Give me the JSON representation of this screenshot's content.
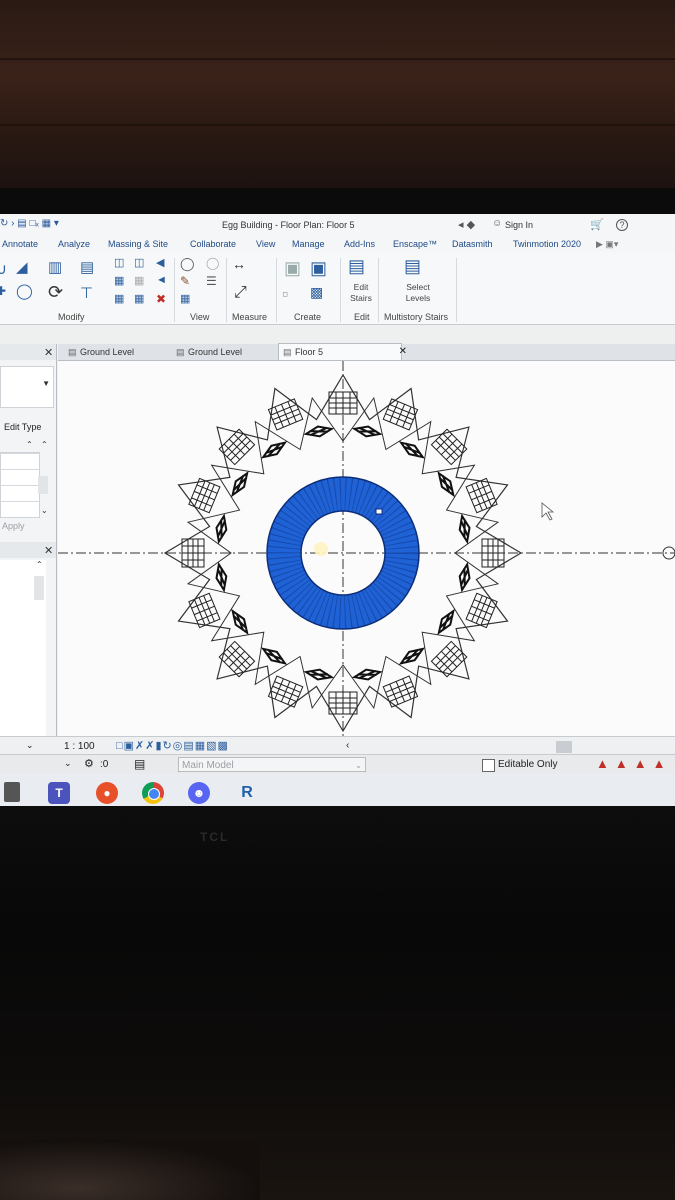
{
  "window": {
    "title": "Egg Building - Floor Plan: Floor 5",
    "sign_in": "Sign In",
    "help": "?"
  },
  "menu": {
    "tabs": [
      "Annotate",
      "Analyze",
      "Massing & Site",
      "Collaborate",
      "View",
      "Manage",
      "Add-Ins",
      "Enscape™",
      "Datasmith",
      "Twinmotion 2020"
    ]
  },
  "ribbon": {
    "groups": [
      "Modify",
      "View",
      "Measure",
      "Create",
      "Edit",
      "Multistory Stairs"
    ],
    "edit_stairs_label": "Edit\nStairs",
    "select_levels_label": "Select\nLevels"
  },
  "properties": {
    "edit_type": "Edit Type",
    "apply": "Apply"
  },
  "view_tabs": [
    {
      "label": "Ground Level",
      "active": false
    },
    {
      "label": "Ground Level",
      "active": false
    },
    {
      "label": "Floor 5",
      "active": true
    }
  ],
  "view_control": {
    "scale": "1 : 100"
  },
  "status": {
    "worksets": ":0",
    "model": "Main Model",
    "editable_only": "Editable Only",
    "editable_only_checked": false
  },
  "taskbar": {
    "apps": [
      "printer-icon",
      "teams-icon",
      "office-icon",
      "chrome-icon",
      "discord-icon",
      "revit-icon"
    ],
    "revit_letter": "R"
  },
  "monitor": {
    "brand": "TCL"
  },
  "colors": {
    "selection_blue": "#1f62d6",
    "ribbon_icon": "#2d5f9e",
    "tab_text": "#1e4a86"
  }
}
